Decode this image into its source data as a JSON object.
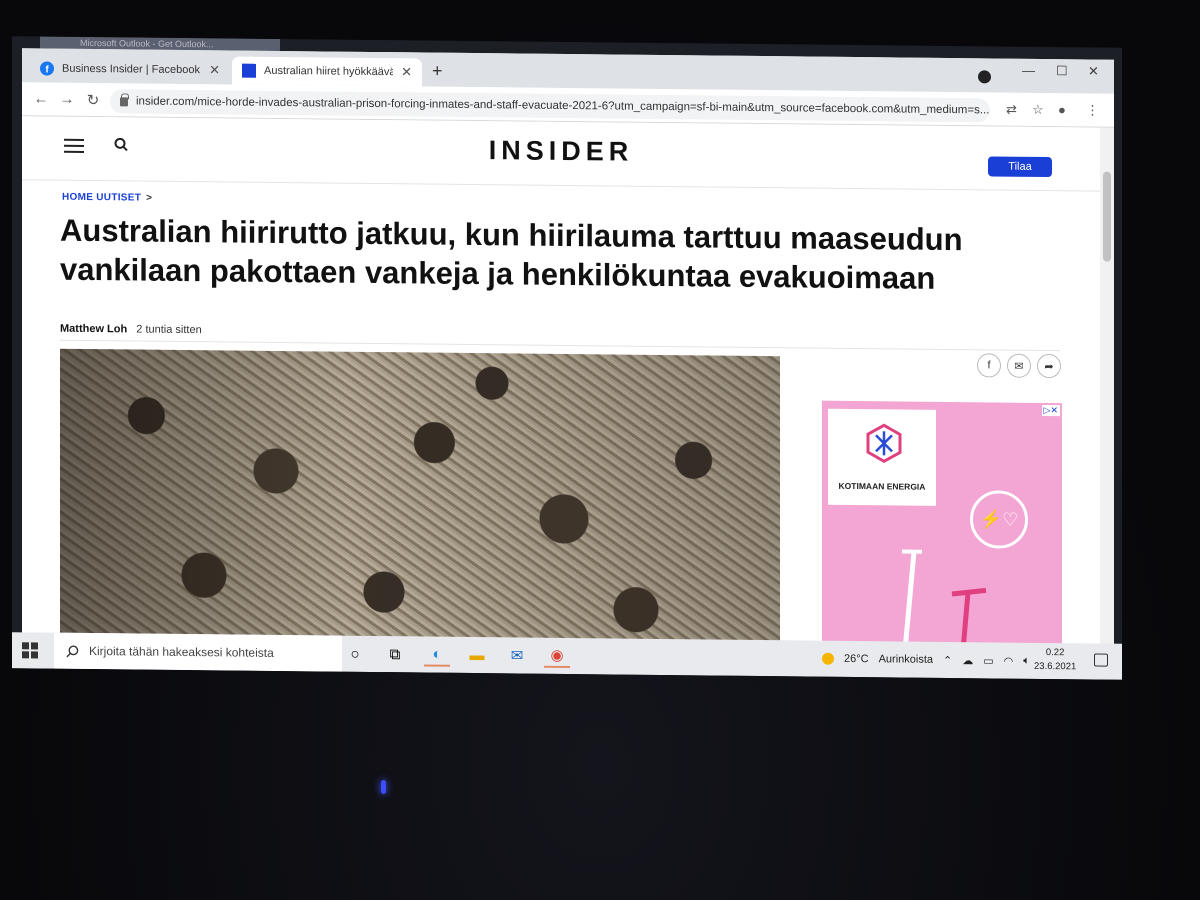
{
  "browser": {
    "ghost_tab_label": "Microsoft Outlook - Get Outlook...",
    "tabs": [
      {
        "title": "Business Insider | Facebook",
        "favicon": "facebook-icon"
      },
      {
        "title": "Australian hiiret hyökkäävät vank",
        "favicon": "insider-icon"
      }
    ],
    "new_tab": "+",
    "url": "insider.com/mice-horde-invades-australian-prison-forcing-inmates-and-staff-evacuate-2021-6?utm_campaign=sf-bi-main&utm_source=facebook.com&utm_medium=s..."
  },
  "site": {
    "logo": "INSIDER",
    "subscribe_label": "Tilaa",
    "breadcrumb": "HOME UUTISET",
    "breadcrumb_chevron": ">",
    "headline": "Australian hiirirutto jatkuu, kun hiirilauma tarttuu maaseudun vankilaan pakottaen vankeja ja henkilökuntaa evakuoimaan",
    "author": "Matthew Loh",
    "time": "2 tuntia sitten",
    "share": [
      "facebook-icon",
      "email-icon",
      "share-icon"
    ]
  },
  "ad": {
    "brand": "KOTIMAAN ENERGIA",
    "badge": "▷✕",
    "colors": {
      "background": "#f3a6d4",
      "accent": "#e0407f"
    }
  },
  "taskbar": {
    "search_placeholder": "Kirjoita tähän hakeaksesi kohteista",
    "weather_temp": "26°C",
    "weather_text": "Aurinkoista",
    "time": "0.22",
    "date": "23.6.2021"
  },
  "colors": {
    "insider_blue": "#1a3fd6",
    "tabbar": "#dee1e6"
  }
}
